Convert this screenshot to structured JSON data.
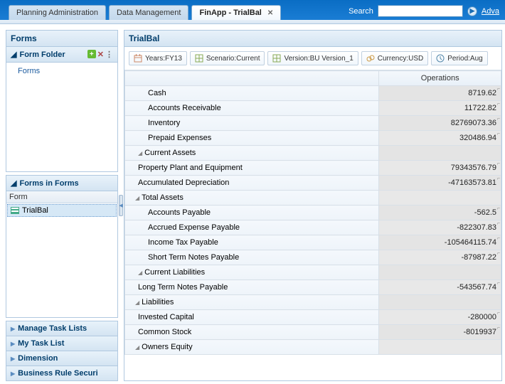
{
  "topbar": {
    "tabs": [
      {
        "label": "Planning Administration"
      },
      {
        "label": "Data Management"
      },
      {
        "label": "FinApp - TrialBal",
        "active": true
      }
    ],
    "search_label": "Search",
    "search_value": "",
    "advanced_label": "Adva"
  },
  "left": {
    "forms_hdr": "Forms",
    "form_folder_hdr": "Form Folder",
    "form_folder_root": "Forms",
    "forms_in_forms_hdr": "Forms in Forms",
    "list_header": "Form",
    "list_item": "TrialBal",
    "stack": [
      "Manage Task Lists",
      "My Task List",
      "Dimension",
      "Business Rule Securi"
    ]
  },
  "content": {
    "title": "TrialBal",
    "pov": [
      {
        "label": "Years:FY13",
        "icon": "calendar"
      },
      {
        "label": "Scenario:Current",
        "icon": "grid"
      },
      {
        "label": "Version:BU Version_1",
        "icon": "grid"
      },
      {
        "label": "Currency:USD",
        "icon": "currency"
      },
      {
        "label": "Period:Aug",
        "icon": "clock"
      }
    ],
    "col_header": "Operations",
    "rows": [
      {
        "label": "Cash",
        "indent": "lvl2",
        "value": "8719.62"
      },
      {
        "label": "Accounts Receivable",
        "indent": "lvl2",
        "value": "11722.82"
      },
      {
        "label": "Inventory",
        "indent": "lvl2",
        "value": "82769073.36"
      },
      {
        "label": "Prepaid Expenses",
        "indent": "lvl2",
        "value": "320486.94"
      },
      {
        "label": "Current Assets",
        "indent": "lvl1",
        "parent": true,
        "value": ""
      },
      {
        "label": "Property Plant and Equipment",
        "indent": "lvl1",
        "value": "79343576.79"
      },
      {
        "label": "Accumulated Depreciation",
        "indent": "lvl1",
        "value": "-47163573.81"
      },
      {
        "label": "Total Assets",
        "indent": "parent",
        "parent": true,
        "value": ""
      },
      {
        "label": "Accounts Payable",
        "indent": "lvl2",
        "value": "-562.5"
      },
      {
        "label": "Accrued Expense Payable",
        "indent": "lvl2",
        "value": "-822307.83"
      },
      {
        "label": "Income Tax Payable",
        "indent": "lvl2",
        "value": "-105464115.74"
      },
      {
        "label": "Short Term Notes Payable",
        "indent": "lvl2",
        "value": "-87987.22"
      },
      {
        "label": "Current Liabilities",
        "indent": "lvl1",
        "parent": true,
        "value": ""
      },
      {
        "label": "Long Term Notes Payable",
        "indent": "lvl1",
        "value": "-543567.74"
      },
      {
        "label": "Liabilities",
        "indent": "parent",
        "parent": true,
        "value": ""
      },
      {
        "label": "Invested Capital",
        "indent": "lvl1",
        "value": "-280000"
      },
      {
        "label": "Common Stock",
        "indent": "lvl1",
        "value": "-8019937"
      },
      {
        "label": "Owners Equity",
        "indent": "parent",
        "parent": true,
        "value": ""
      }
    ]
  }
}
